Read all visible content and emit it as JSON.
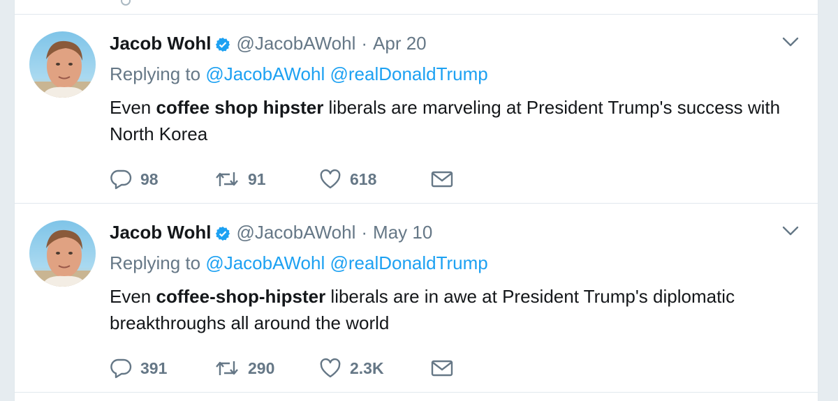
{
  "tweets": [
    {
      "author": {
        "name": "Jacob Wohl",
        "handle": "@JacobAWohl"
      },
      "separator": "·",
      "date": "Apr 20",
      "replying_to": {
        "label": "Replying to",
        "mentions": [
          "@JacobAWohl",
          "@realDonaldTrump"
        ]
      },
      "text": {
        "pre": "Even ",
        "bold": "coffee shop hipster",
        "post": " liberals are marveling at President Trump's success with North Korea"
      },
      "stats": {
        "replies": "98",
        "retweets": "91",
        "likes": "618"
      }
    },
    {
      "author": {
        "name": "Jacob Wohl",
        "handle": "@JacobAWohl"
      },
      "separator": "·",
      "date": "May 10",
      "replying_to": {
        "label": "Replying to",
        "mentions": [
          "@JacobAWohl",
          "@realDonaldTrump"
        ]
      },
      "text": {
        "pre": "Even ",
        "bold": "coffee-shop-hipster",
        "post": " liberals are in awe at President Trump's diplomatic breakthroughs all around the world"
      },
      "stats": {
        "replies": "391",
        "retweets": "290",
        "likes": "2.3K"
      }
    }
  ],
  "icons": [
    "verified-badge-icon",
    "chevron-down-icon",
    "reply-icon",
    "retweet-icon",
    "like-icon",
    "message-icon"
  ],
  "colors": {
    "link": "#1da1f2",
    "muted": "#657786",
    "text": "#14171a",
    "border": "#e1e8ed",
    "background": "#e6ecf0"
  }
}
